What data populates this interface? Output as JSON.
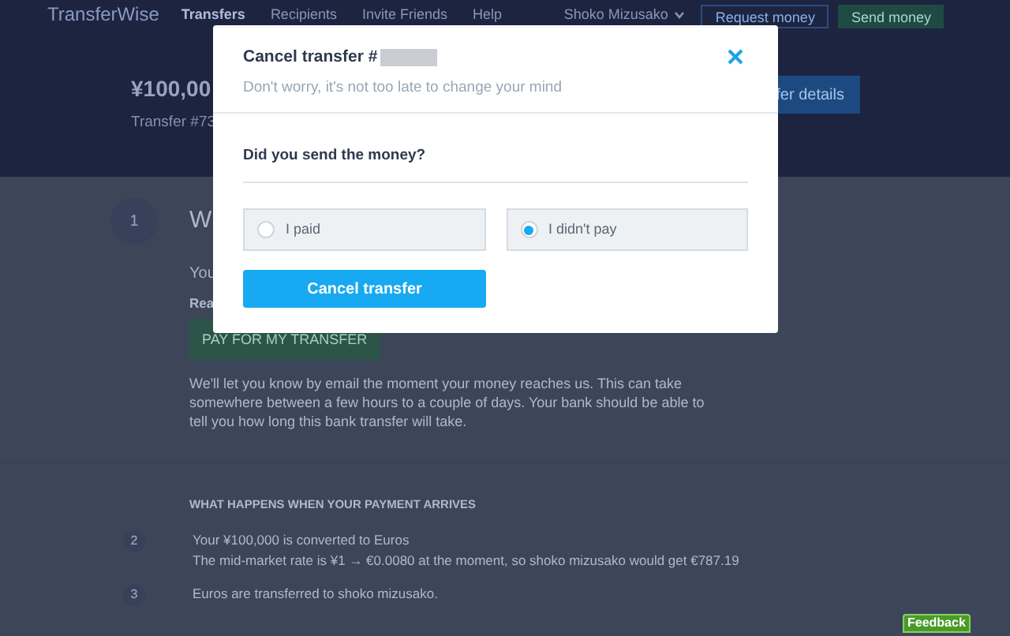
{
  "header": {
    "logo": "TransferWise",
    "nav": [
      {
        "label": "Transfers",
        "selected": true
      },
      {
        "label": "Recipients",
        "selected": false
      },
      {
        "label": "Invite Friends",
        "selected": false
      },
      {
        "label": "Help",
        "selected": false
      }
    ],
    "user": "Shoko Mizusako",
    "request_button": "Request money",
    "send_button": "Send money"
  },
  "hero": {
    "amount": "¥100,00",
    "transfer": "Transfer #73",
    "details_button": "fer details"
  },
  "step1": {
    "number": "1",
    "heading": "W",
    "line_1": "You",
    "line_2": "Rea",
    "pay_button": "PAY FOR MY TRANSFER",
    "paragraph": "We'll let you know by email the moment your money reaches us. This can take somewhere between a few hours to a couple of days. Your bank should be able to tell you how long this bank transfer will take."
  },
  "after": {
    "heading": "WHAT HAPPENS WHEN YOUR PAYMENT ARRIVES",
    "steps": [
      {
        "number": "2",
        "lines": [
          "Your ¥100,000 is converted to Euros",
          "The mid-market rate is ¥1 → €0.0080 at the moment, so shoko mizusako would get €787.19"
        ]
      },
      {
        "number": "3",
        "lines": [
          "Euros are transferred to shoko mizusako."
        ]
      }
    ]
  },
  "feedback": "Feedback",
  "modal": {
    "title": "Cancel transfer #",
    "subtitle": "Don't worry, it's not too late to change your mind",
    "question": "Did you send the money?",
    "options": [
      {
        "label": "I paid",
        "selected": false
      },
      {
        "label": "I didn't pay",
        "selected": true
      }
    ],
    "submit": "Cancel transfer"
  }
}
